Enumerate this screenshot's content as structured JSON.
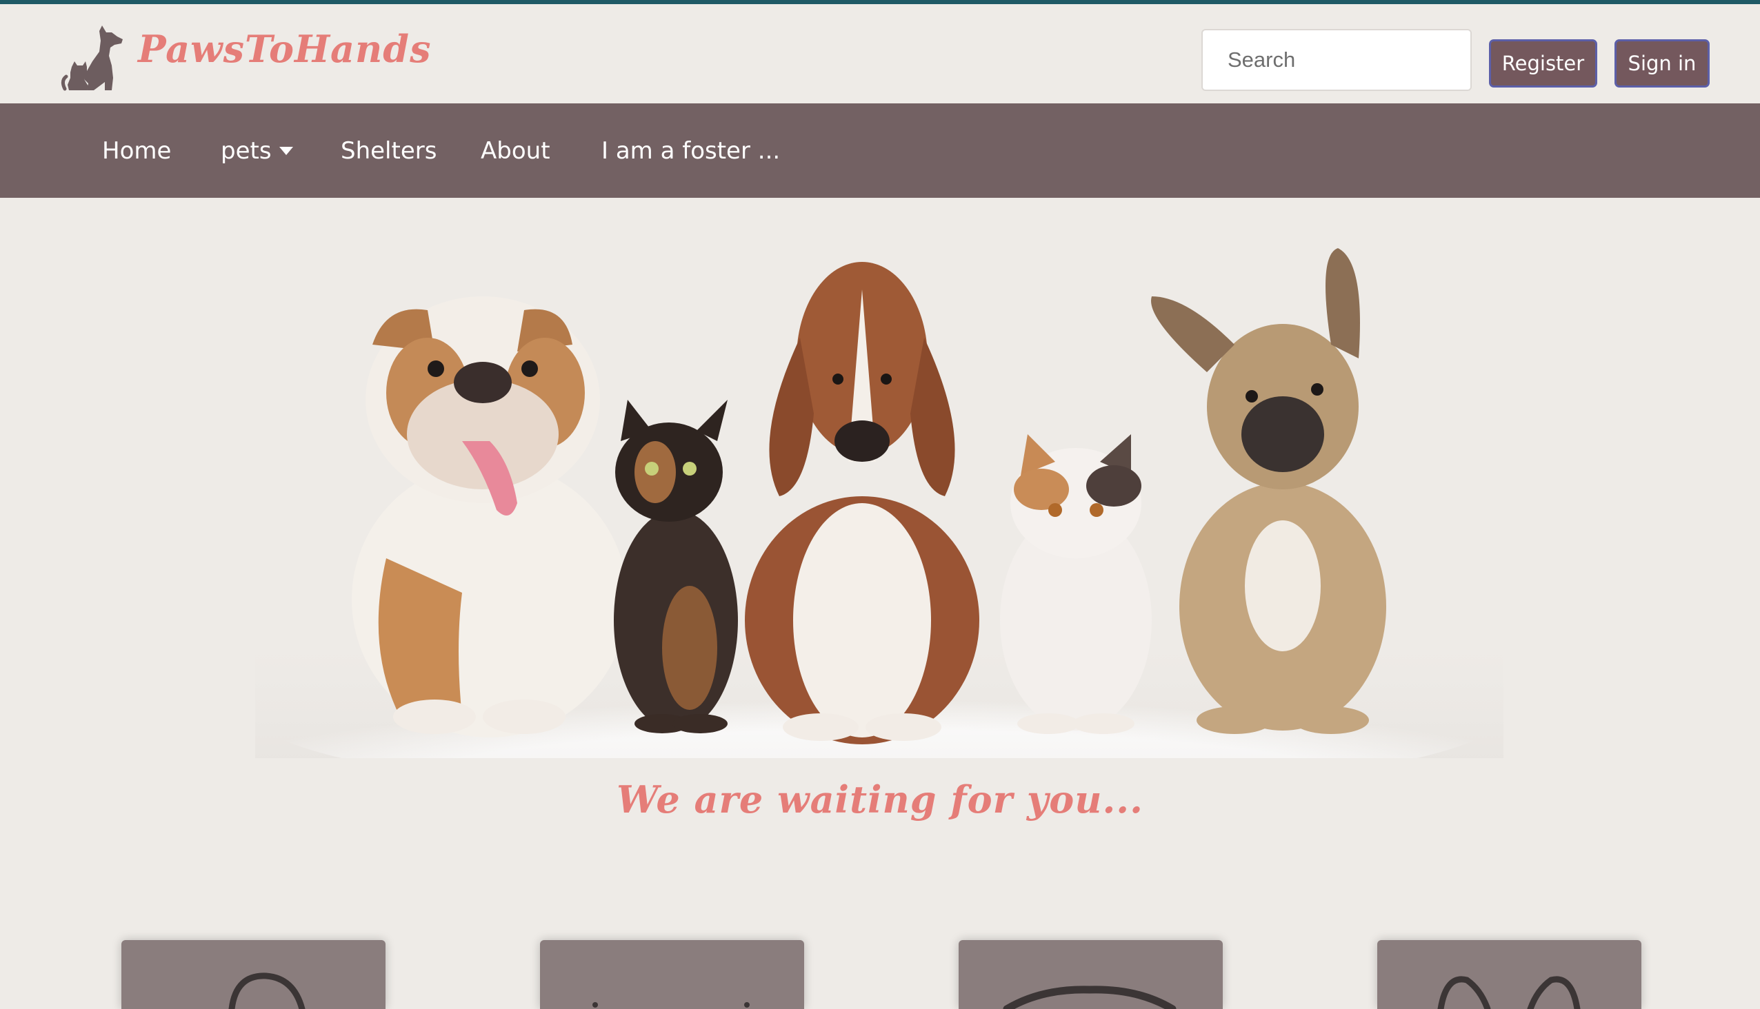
{
  "header": {
    "brand_name": "PawsToHands",
    "logo_icon": "dog-and-cat-logo-icon",
    "search": {
      "placeholder": "Search",
      "value": ""
    },
    "register_label": "Register",
    "signin_label": "Sign in"
  },
  "nav": {
    "items": [
      {
        "label": "Home"
      },
      {
        "label": "pets",
        "has_dropdown": true
      },
      {
        "label": "Shelters"
      },
      {
        "label": "About"
      },
      {
        "label": "I am a foster ..."
      }
    ]
  },
  "hero": {
    "image": "dogs-and-cats-group-photo",
    "tagline": "We are waiting for you..."
  },
  "categories": [
    {
      "icon": "pet-category-icon-1"
    },
    {
      "icon": "pet-category-icon-2"
    },
    {
      "icon": "pet-category-icon-3"
    },
    {
      "icon": "pet-category-icon-4"
    }
  ],
  "colors": {
    "accent_pink": "#e57d78",
    "nav_bg": "#736163",
    "button_bg": "#74585d",
    "page_bg": "#eeebe7",
    "top_accent": "#1f5a66"
  }
}
